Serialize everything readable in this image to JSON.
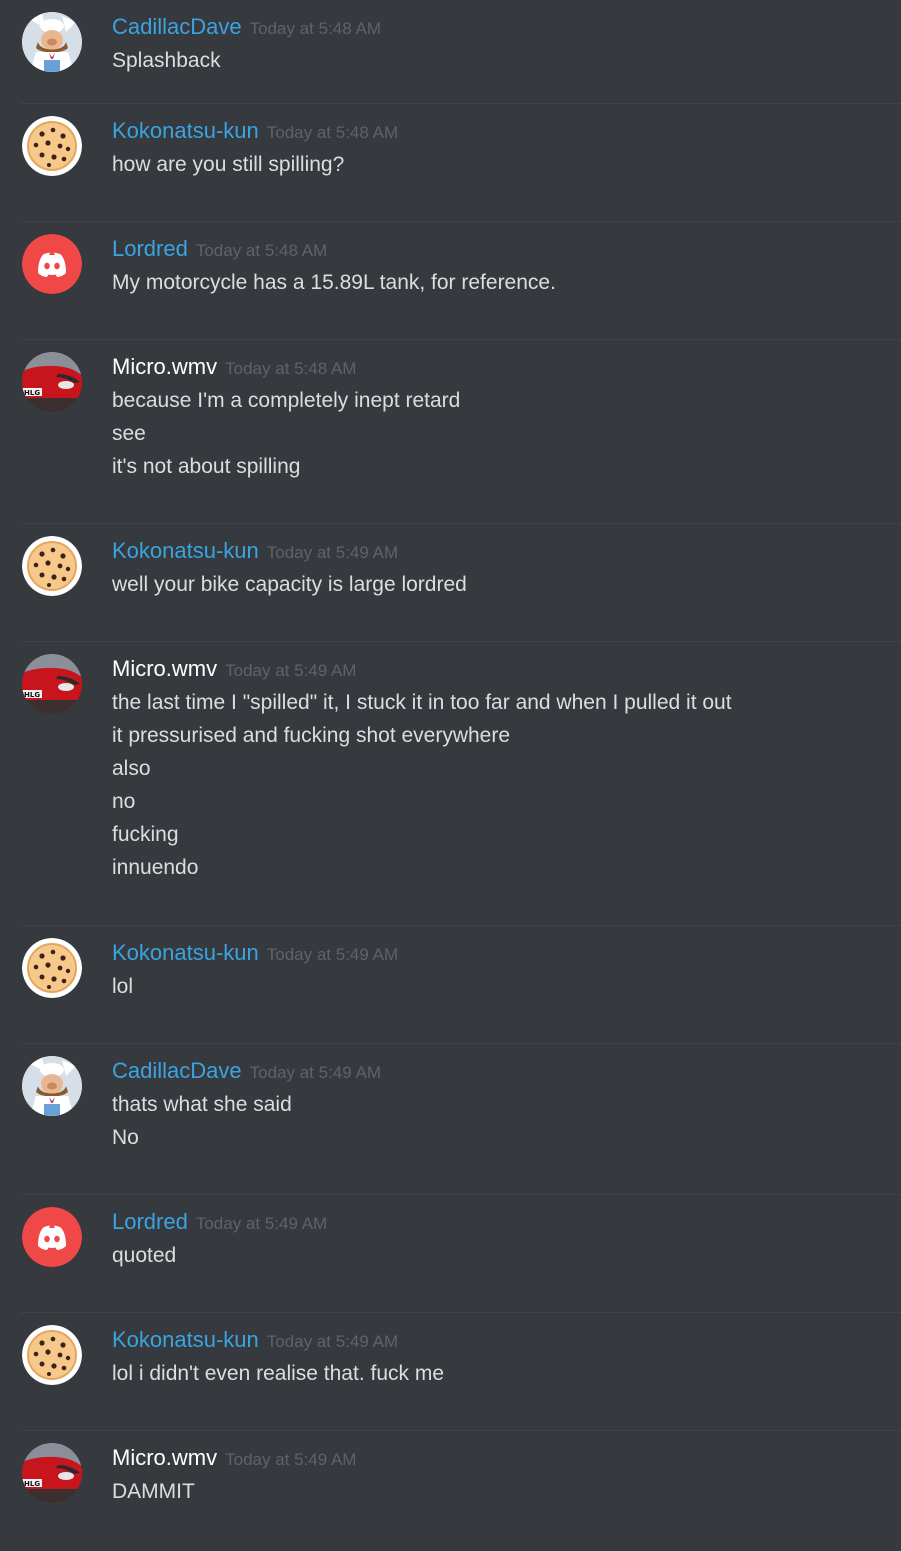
{
  "colors": {
    "background": "#36393e",
    "username_blue": "#3ba4e0",
    "username_white": "#ffffff",
    "timestamp": "#5f6368",
    "text": "#dcddde",
    "divider": "#3f4247"
  },
  "messages": [
    {
      "username": "CadillacDave",
      "user_color": "#3ba4e0",
      "avatar": "swedish-chef-avatar-icon",
      "timestamp": "Today at 5:48 AM",
      "lines": [
        "Splashback"
      ]
    },
    {
      "username": "Kokonatsu-kun",
      "user_color": "#3ba4e0",
      "avatar": "cookie-avatar-icon",
      "timestamp": "Today at 5:48 AM",
      "lines": [
        "how are you still spilling?"
      ]
    },
    {
      "username": "Lordred",
      "user_color": "#3ba4e0",
      "avatar": "discord-logo-avatar-icon",
      "timestamp": "Today at 5:48 AM",
      "lines": [
        "My motorcycle has a 15.89L tank, for reference."
      ]
    },
    {
      "username": "Micro.wmv",
      "user_color": "#ffffff",
      "avatar": "red-car-avatar-icon",
      "timestamp": "Today at 5:48 AM",
      "lines": [
        "because I'm a completely inept retard",
        "see",
        "it's not about spilling"
      ]
    },
    {
      "username": "Kokonatsu-kun",
      "user_color": "#3ba4e0",
      "avatar": "cookie-avatar-icon",
      "timestamp": "Today at 5:49 AM",
      "lines": [
        "well your bike capacity is large lordred"
      ]
    },
    {
      "username": "Micro.wmv",
      "user_color": "#ffffff",
      "avatar": "red-car-avatar-icon",
      "timestamp": "Today at 5:49 AM",
      "lines": [
        "the last time I \"spilled\" it, I stuck it in too far and when I pulled it out",
        "it pressurised and fucking shot everywhere",
        "also",
        "no",
        "fucking",
        "innuendo"
      ]
    },
    {
      "username": "Kokonatsu-kun",
      "user_color": "#3ba4e0",
      "avatar": "cookie-avatar-icon",
      "timestamp": "Today at 5:49 AM",
      "lines": [
        "lol"
      ]
    },
    {
      "username": "CadillacDave",
      "user_color": "#3ba4e0",
      "avatar": "swedish-chef-avatar-icon",
      "timestamp": "Today at 5:49 AM",
      "lines": [
        "thats what she said",
        "No"
      ]
    },
    {
      "username": "Lordred",
      "user_color": "#3ba4e0",
      "avatar": "discord-logo-avatar-icon",
      "timestamp": "Today at 5:49 AM",
      "lines": [
        "quoted"
      ]
    },
    {
      "username": "Kokonatsu-kun",
      "user_color": "#3ba4e0",
      "avatar": "cookie-avatar-icon",
      "timestamp": "Today at 5:49 AM",
      "lines": [
        "lol i didn't even realise that. fuck me"
      ]
    },
    {
      "username": "Micro.wmv",
      "user_color": "#ffffff",
      "avatar": "red-car-avatar-icon",
      "timestamp": "Today at 5:49 AM",
      "lines": [
        "DAMMIT"
      ]
    }
  ]
}
